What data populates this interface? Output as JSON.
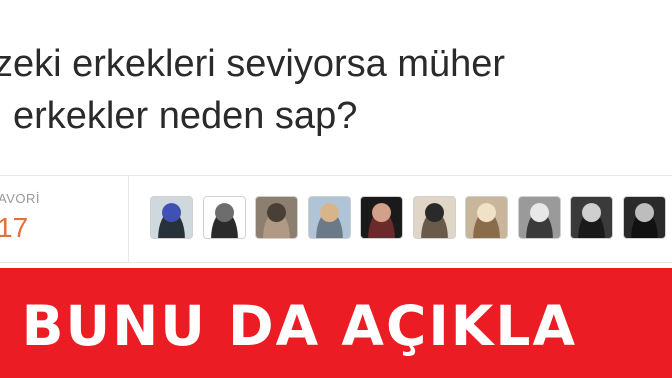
{
  "tweet": {
    "line1": "zeki erkekleri seviyorsa müher",
    "line2": "l erkekler neden sap?"
  },
  "stats": {
    "favorites_label": "AVORİ",
    "favorites_count": "17"
  },
  "avatars": [
    {
      "name": "avatar-1",
      "colors": [
        "#cfd8dc",
        "#3f51b5",
        "#263238"
      ]
    },
    {
      "name": "avatar-2",
      "colors": [
        "#ffffff",
        "#6d6d6d",
        "#2b2b2b"
      ]
    },
    {
      "name": "avatar-3",
      "colors": [
        "#8d7f6f",
        "#4a3f36",
        "#b09a85"
      ]
    },
    {
      "name": "avatar-4",
      "colors": [
        "#b0c4d8",
        "#d8b48a",
        "#6b7a88"
      ]
    },
    {
      "name": "avatar-5",
      "colors": [
        "#1a1a1a",
        "#d1a18a",
        "#6b2b2b"
      ]
    },
    {
      "name": "avatar-6",
      "colors": [
        "#e0d6c8",
        "#2a2a2a",
        "#6a5a4a"
      ]
    },
    {
      "name": "avatar-7",
      "colors": [
        "#c8b59a",
        "#f0e2c6",
        "#8a6b4a"
      ]
    },
    {
      "name": "avatar-8",
      "colors": [
        "#9a9a9a",
        "#e8e8e8",
        "#3a3a3a"
      ]
    },
    {
      "name": "avatar-9",
      "colors": [
        "#3a3a3a",
        "#cfcfcf",
        "#1a1a1a"
      ]
    },
    {
      "name": "avatar-10",
      "colors": [
        "#2a2a2a",
        "#bdbdbd",
        "#111111"
      ]
    }
  ],
  "banner": {
    "text": "İ BUNU DA AÇIKLA",
    "color": "#ec1c24"
  }
}
